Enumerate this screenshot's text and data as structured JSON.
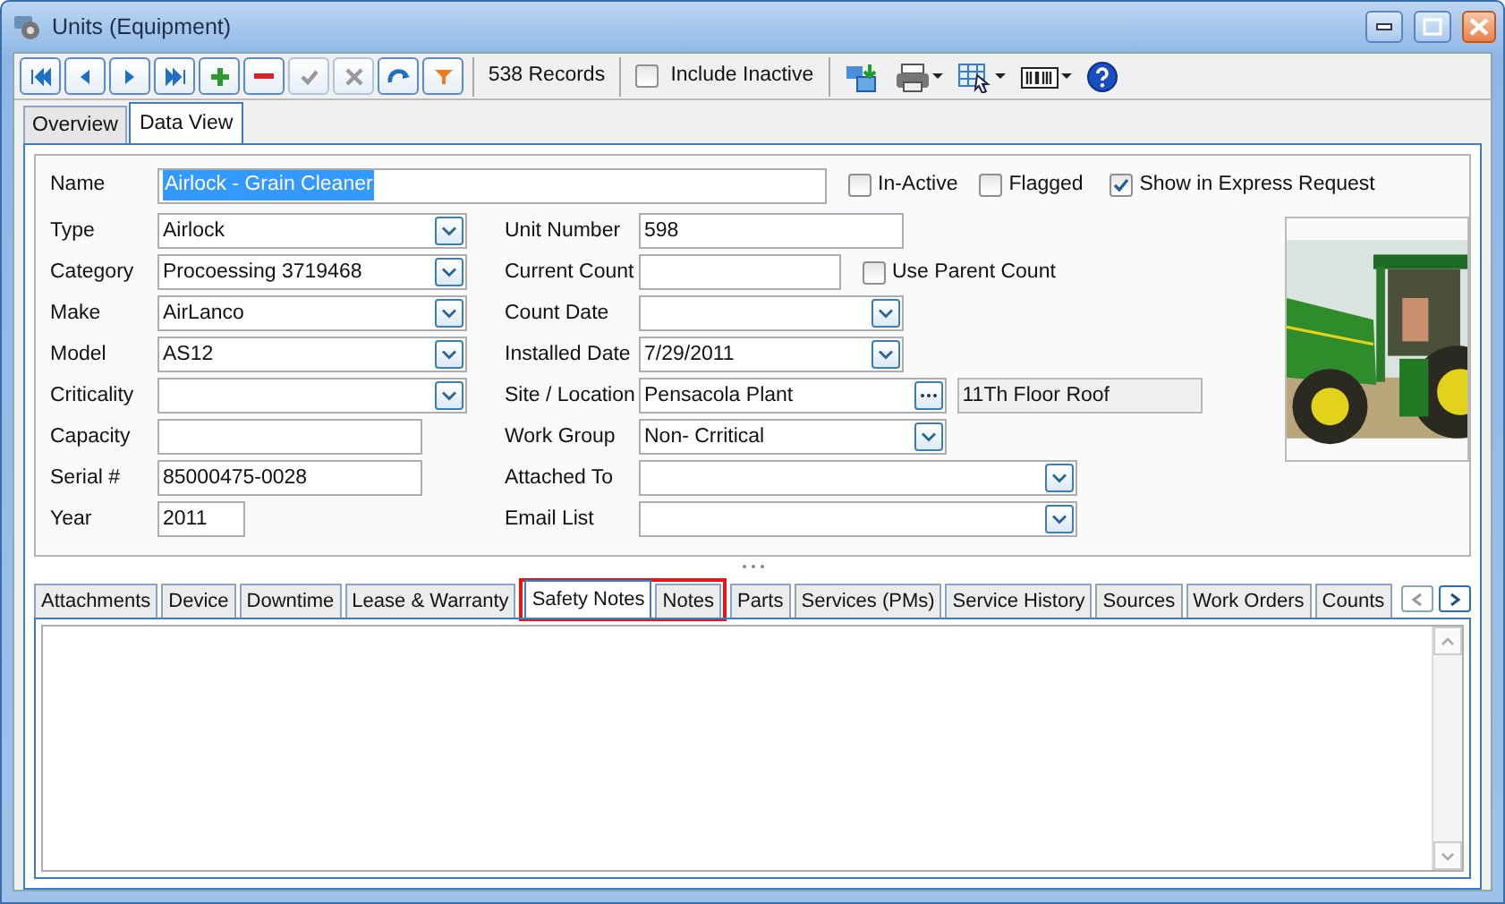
{
  "window": {
    "title": "Units (Equipment)"
  },
  "toolbar": {
    "buttons": [
      {
        "kind": "first",
        "disabled": false
      },
      {
        "kind": "prev",
        "disabled": false
      },
      {
        "kind": "next",
        "disabled": false
      },
      {
        "kind": "last",
        "disabled": false
      },
      {
        "kind": "add",
        "disabled": false
      },
      {
        "kind": "delete",
        "disabled": false
      },
      {
        "kind": "save",
        "disabled": true
      },
      {
        "kind": "cancel",
        "disabled": true
      },
      {
        "kind": "refresh",
        "disabled": false
      },
      {
        "kind": "filter",
        "disabled": false
      }
    ],
    "record_count": "538 Records",
    "include_inactive": {
      "label": "Include Inactive",
      "checked": false
    },
    "tools": [
      {
        "kind": "export"
      },
      {
        "kind": "print"
      },
      {
        "kind": "grid"
      },
      {
        "kind": "barcode"
      },
      {
        "kind": "help"
      }
    ]
  },
  "tabs": [
    {
      "label": "Overview",
      "selected": false
    },
    {
      "label": "Data View",
      "selected": true
    }
  ],
  "form": {
    "name": {
      "label": "Name",
      "value": "Airlock - Grain Cleaner"
    },
    "flags": [
      {
        "label": "In-Active",
        "checked": false
      },
      {
        "label": "Flagged",
        "checked": false
      },
      {
        "label": "Show in Express Request",
        "checked": true
      }
    ],
    "rows": [
      {
        "left": {
          "label": "Type",
          "value": "Airlock",
          "kind": "combo"
        },
        "right": {
          "label": "Unit Number",
          "value": "598",
          "kind": "text"
        }
      },
      {
        "left": {
          "label": "Category",
          "value": "Procoessing 3719468",
          "kind": "combo"
        },
        "right": {
          "label": "Current Count",
          "kind": "text"
        },
        "checkbox": {
          "label": "Use Parent Count",
          "checked": false
        }
      },
      {
        "left": {
          "label": "Make",
          "value": "AirLanco",
          "kind": "combo"
        },
        "right": {
          "label": "Count Date",
          "kind": "combo"
        }
      },
      {
        "left": {
          "label": "Model",
          "value": "AS12",
          "kind": "combo"
        },
        "right": {
          "label": "Installed Date",
          "value": "7/29/2011",
          "kind": "combo"
        }
      },
      {
        "left": {
          "label": "Criticality",
          "kind": "combo"
        },
        "right": {
          "label": "Site / Location",
          "value": "Pensacola Plant",
          "kind": "lookup"
        },
        "extra": "11Th Floor Roof"
      },
      {
        "left": {
          "label": "Capacity",
          "kind": "text"
        },
        "right": {
          "label": "Work Group",
          "value": "Non- Crritical",
          "kind": "combo"
        }
      },
      {
        "left": {
          "label": "Serial #",
          "value": "85000475-0028",
          "kind": "text"
        },
        "right": {
          "label": "Attached To",
          "kind": "combo"
        }
      },
      {
        "left": {
          "label": "Year",
          "value": "2011",
          "kind": "text"
        },
        "right": {
          "label": "Email List",
          "kind": "combo"
        }
      }
    ]
  },
  "bottom_tabs": [
    {
      "label": "Attachments",
      "selected": false,
      "highlighted": false
    },
    {
      "label": "Device",
      "selected": false,
      "highlighted": false
    },
    {
      "label": "Downtime",
      "selected": false,
      "highlighted": false
    },
    {
      "label": "Lease & Warranty",
      "selected": false,
      "highlighted": false
    },
    {
      "label": "Safety Notes",
      "selected": true,
      "highlighted": true
    },
    {
      "label": "Notes",
      "selected": false,
      "highlighted": true
    },
    {
      "label": "Parts",
      "selected": false,
      "highlighted": false
    },
    {
      "label": "Services (PMs)",
      "selected": false,
      "highlighted": false
    },
    {
      "label": "Service History",
      "selected": false,
      "highlighted": false
    },
    {
      "label": "Sources",
      "selected": false,
      "highlighted": false
    },
    {
      "label": "Work Orders",
      "selected": false,
      "highlighted": false
    },
    {
      "label": "Counts",
      "selected": false,
      "highlighted": false
    }
  ]
}
